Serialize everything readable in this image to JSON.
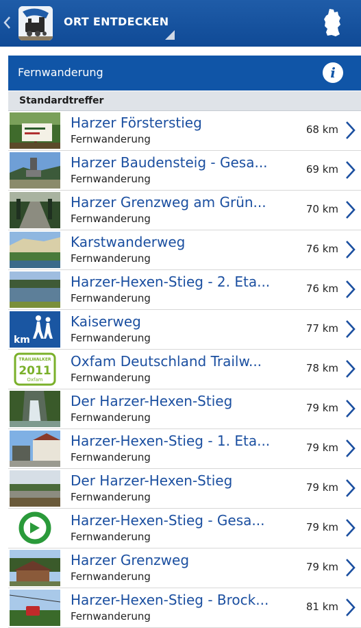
{
  "app_bar": {
    "title": "ORT ENTDECKEN",
    "back_icon": "chevron-left-icon",
    "app_icon": "train-app-icon",
    "map_icon": "germany-map-icon"
  },
  "header": {
    "label": "Fernwanderung",
    "info_glyph": "i"
  },
  "section": {
    "label": "Standardtreffer"
  },
  "items": [
    {
      "title": "Harzer Försterstieg",
      "category": "Fernwanderung",
      "distance": "68 km",
      "thumb": "signpost-photo"
    },
    {
      "title": "Harzer Baudensteig - Gesa...",
      "category": "Fernwanderung",
      "distance": "69 km",
      "thumb": "tower-landscape-photo"
    },
    {
      "title": "Harzer Grenzweg am Grün...",
      "category": "Fernwanderung",
      "distance": "70 km",
      "thumb": "forest-path-photo"
    },
    {
      "title": "Karstwanderweg",
      "category": "Fernwanderung",
      "distance": "76 km",
      "thumb": "cliff-lake-photo"
    },
    {
      "title": "Harzer-Hexen-Stieg - 2. Eta...",
      "category": "Fernwanderung",
      "distance": "76 km",
      "thumb": "lake-photo"
    },
    {
      "title": "Kaiserweg",
      "category": "Fernwanderung",
      "distance": "77 km",
      "thumb": "hiking-km-icon"
    },
    {
      "title": "Oxfam Deutschland Trailw...",
      "category": "Fernwanderung",
      "distance": "78 km",
      "thumb": "trailwalker-logo"
    },
    {
      "title": "Der Harzer-Hexen-Stieg",
      "category": "Fernwanderung",
      "distance": "79 km",
      "thumb": "waterfall-photo"
    },
    {
      "title": "Harzer-Hexen-Stieg - 1. Eta...",
      "category": "Fernwanderung",
      "distance": "79 km",
      "thumb": "town-square-photo"
    },
    {
      "title": "Der Harzer-Hexen-Stieg",
      "category": "Fernwanderung",
      "distance": "79 km",
      "thumb": "dam-photo"
    },
    {
      "title": "Harzer-Hexen-Stieg - Gesa...",
      "category": "Fernwanderung",
      "distance": "79 km",
      "thumb": "green-circle-logo"
    },
    {
      "title": "Harzer Grenzweg",
      "category": "Fernwanderung",
      "distance": "79 km",
      "thumb": "cabin-photo"
    },
    {
      "title": "Harzer-Hexen-Stieg - Brock...",
      "category": "Fernwanderung",
      "distance": "81 km",
      "thumb": "cable-car-photo"
    }
  ],
  "logo_text": {
    "trailwalker_top": "TRAILWALKER",
    "trailwalker_year": "2011",
    "trailwalker_brand": "Oxfam",
    "kaiserweg_km": "km"
  },
  "colors": {
    "app_bar": "#1a56a2",
    "header": "#1055a7",
    "title_text": "#1b4fa0",
    "section_bg": "#dfe3e8"
  }
}
